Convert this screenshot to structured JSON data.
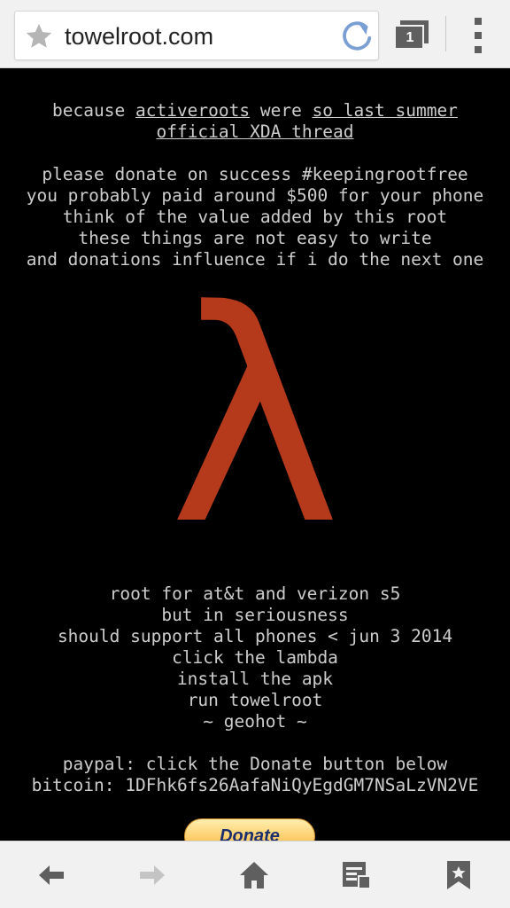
{
  "browser": {
    "url": "towelroot.com",
    "tab_count": "1"
  },
  "page": {
    "intro": {
      "prefix": "because ",
      "link_activeroots": "activeroots",
      "middle": " were ",
      "link_summer": "so last summer",
      "link_xda": "official XDA thread"
    },
    "donate_lines": [
      "please donate on success #keepingrootfree",
      "you probably paid around $500 for your phone",
      "think of the value added by this root",
      "these things are not easy to write",
      "and donations influence if i do the next one"
    ],
    "lambda_symbol": "λ",
    "info_lines": [
      "root for at&t and verizon s5",
      "but in seriousness",
      "should support all phones < jun 3 2014",
      "click the lambda",
      "install the apk",
      "run towelroot",
      "~ geohot ~"
    ],
    "payment_lines": [
      "paypal: click the Donate button below",
      "bitcoin: 1DFhk6fs26AafaNiQyEgdGM7NSaLzVN2VE"
    ],
    "donate_button": "Donate"
  },
  "colors": {
    "background": "#000000",
    "text": "#cdcdcd",
    "lambda": "#b53a1b",
    "bar": "#f1f1f1",
    "icon": "#5f5f5f"
  },
  "icons": {
    "star": "star-icon",
    "reload": "reload-icon",
    "tabs": "tabs-icon",
    "menu": "overflow-menu-icon",
    "back": "back-arrow-icon",
    "forward": "forward-arrow-icon",
    "home": "home-icon",
    "bookmarks": "bookmarks-icon",
    "add_bookmark": "add-bookmark-icon"
  }
}
